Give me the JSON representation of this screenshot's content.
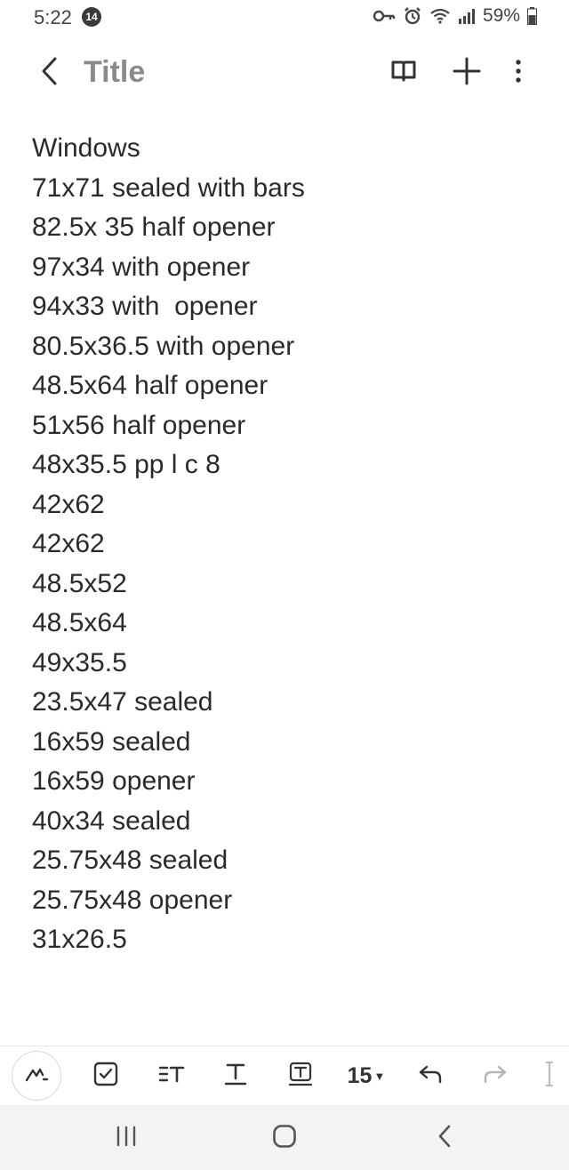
{
  "status_bar": {
    "time": "5:22",
    "notification_count": "14",
    "battery": "59%",
    "icons": [
      "key-icon",
      "alarm-icon",
      "wifi-icon",
      "signal-icon",
      "battery-icon"
    ]
  },
  "app_bar": {
    "title": "Title",
    "icons": [
      "back-icon",
      "reading-mode-icon",
      "add-icon",
      "more-icon"
    ]
  },
  "note": {
    "lines": [
      "Windows",
      "71x71 sealed with bars",
      "82.5x 35 half opener",
      "97x34 with opener",
      "94x33 with  opener",
      "80.5x36.5 with opener",
      "48.5x64 half opener",
      "51x56 half opener",
      "48x35.5 pp l c 8",
      "42x62",
      "42x62",
      "48.5x52",
      "48.5x64",
      "49x35.5",
      "23.5x47 sealed",
      "16x59 sealed",
      "16x59 opener",
      "40x34 sealed",
      "25.75x48 sealed",
      "25.75x48 opener",
      "31x26.5"
    ]
  },
  "toolbar": {
    "font_size": "15",
    "icons": [
      "pen-icon",
      "checkbox-icon",
      "text-style-icon",
      "text-format-icon",
      "text-box-icon",
      "undo-icon",
      "redo-icon",
      "more-tools-icon"
    ]
  },
  "colors": {
    "title": "#8a8a8a",
    "text": "#2a2a2a",
    "navbar": "#f3f3f3"
  }
}
